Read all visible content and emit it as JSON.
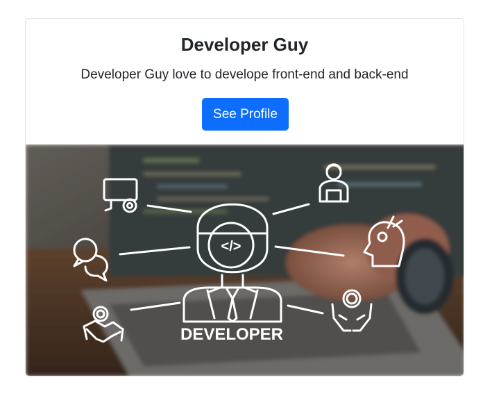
{
  "card": {
    "title": "Developer Guy",
    "text": "Developer Guy love to develope front-end and back-end",
    "button_label": "See Profile"
  },
  "image": {
    "caption": "DEVELOPER",
    "code_symbol": "</>"
  },
  "colors": {
    "primary": "#0d6efd",
    "border": "#dee2e6"
  }
}
